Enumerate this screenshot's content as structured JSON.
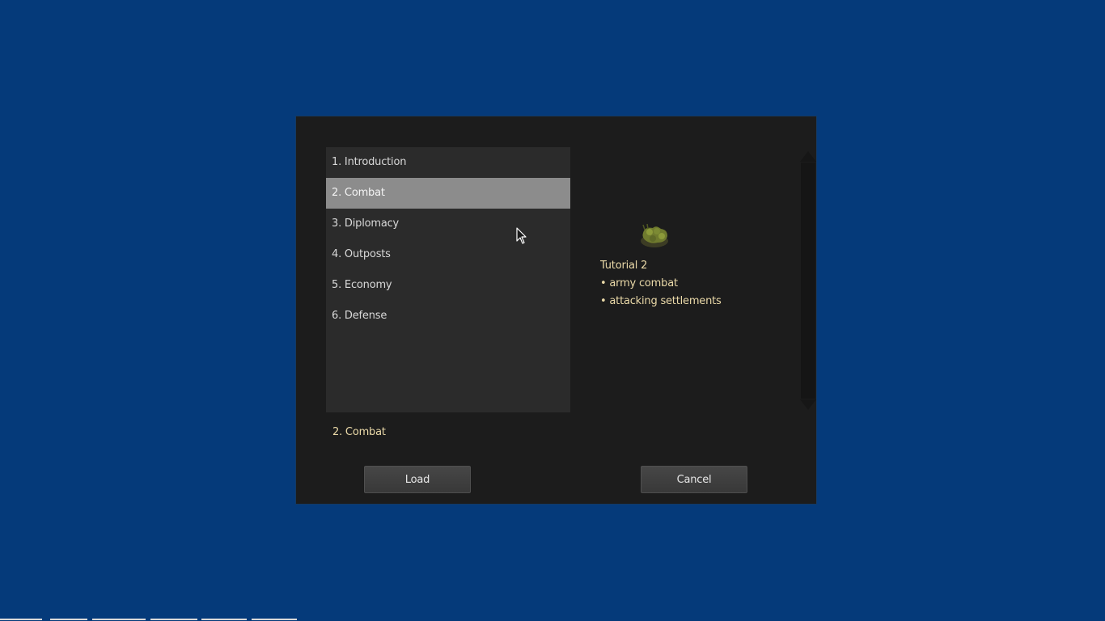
{
  "tutorial_list": {
    "items": [
      {
        "label": "1. Introduction",
        "selected": false
      },
      {
        "label": "2. Combat",
        "selected": true
      },
      {
        "label": "3. Diplomacy",
        "selected": false
      },
      {
        "label": "4. Outposts",
        "selected": false
      },
      {
        "label": "5. Economy",
        "selected": false
      },
      {
        "label": "6. Defense",
        "selected": false
      }
    ]
  },
  "preview": {
    "image_icon": "army-unit-icon",
    "title": "Tutorial 2",
    "bullets": [
      "• army combat",
      "• attacking settlements"
    ]
  },
  "selected_name": "2. Combat",
  "buttons": {
    "load_label": "Load",
    "cancel_label": "Cancel"
  },
  "colors": {
    "desktop_background": "#053a7a",
    "dialog_background": "#1c1c1c",
    "list_background": "#2b2b2b",
    "selection_highlight": "#8c8c8c",
    "accent_text": "#ead9a8"
  }
}
